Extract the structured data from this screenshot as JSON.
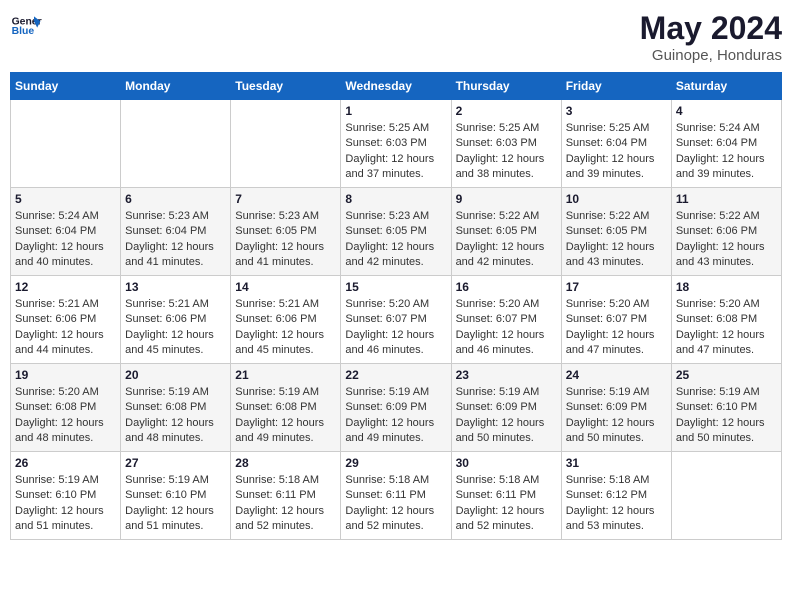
{
  "header": {
    "logo_line1": "General",
    "logo_line2": "Blue",
    "month_year": "May 2024",
    "location": "Guinope, Honduras"
  },
  "weekdays": [
    "Sunday",
    "Monday",
    "Tuesday",
    "Wednesday",
    "Thursday",
    "Friday",
    "Saturday"
  ],
  "weeks": [
    [
      {
        "day": "",
        "info": ""
      },
      {
        "day": "",
        "info": ""
      },
      {
        "day": "",
        "info": ""
      },
      {
        "day": "1",
        "sunrise": "5:25 AM",
        "sunset": "6:03 PM",
        "daylight": "12 hours and 37 minutes."
      },
      {
        "day": "2",
        "sunrise": "5:25 AM",
        "sunset": "6:03 PM",
        "daylight": "12 hours and 38 minutes."
      },
      {
        "day": "3",
        "sunrise": "5:25 AM",
        "sunset": "6:04 PM",
        "daylight": "12 hours and 39 minutes."
      },
      {
        "day": "4",
        "sunrise": "5:24 AM",
        "sunset": "6:04 PM",
        "daylight": "12 hours and 39 minutes."
      }
    ],
    [
      {
        "day": "5",
        "sunrise": "5:24 AM",
        "sunset": "6:04 PM",
        "daylight": "12 hours and 40 minutes."
      },
      {
        "day": "6",
        "sunrise": "5:23 AM",
        "sunset": "6:04 PM",
        "daylight": "12 hours and 41 minutes."
      },
      {
        "day": "7",
        "sunrise": "5:23 AM",
        "sunset": "6:05 PM",
        "daylight": "12 hours and 41 minutes."
      },
      {
        "day": "8",
        "sunrise": "5:23 AM",
        "sunset": "6:05 PM",
        "daylight": "12 hours and 42 minutes."
      },
      {
        "day": "9",
        "sunrise": "5:22 AM",
        "sunset": "6:05 PM",
        "daylight": "12 hours and 42 minutes."
      },
      {
        "day": "10",
        "sunrise": "5:22 AM",
        "sunset": "6:05 PM",
        "daylight": "12 hours and 43 minutes."
      },
      {
        "day": "11",
        "sunrise": "5:22 AM",
        "sunset": "6:06 PM",
        "daylight": "12 hours and 43 minutes."
      }
    ],
    [
      {
        "day": "12",
        "sunrise": "5:21 AM",
        "sunset": "6:06 PM",
        "daylight": "12 hours and 44 minutes."
      },
      {
        "day": "13",
        "sunrise": "5:21 AM",
        "sunset": "6:06 PM",
        "daylight": "12 hours and 45 minutes."
      },
      {
        "day": "14",
        "sunrise": "5:21 AM",
        "sunset": "6:06 PM",
        "daylight": "12 hours and 45 minutes."
      },
      {
        "day": "15",
        "sunrise": "5:20 AM",
        "sunset": "6:07 PM",
        "daylight": "12 hours and 46 minutes."
      },
      {
        "day": "16",
        "sunrise": "5:20 AM",
        "sunset": "6:07 PM",
        "daylight": "12 hours and 46 minutes."
      },
      {
        "day": "17",
        "sunrise": "5:20 AM",
        "sunset": "6:07 PM",
        "daylight": "12 hours and 47 minutes."
      },
      {
        "day": "18",
        "sunrise": "5:20 AM",
        "sunset": "6:08 PM",
        "daylight": "12 hours and 47 minutes."
      }
    ],
    [
      {
        "day": "19",
        "sunrise": "5:20 AM",
        "sunset": "6:08 PM",
        "daylight": "12 hours and 48 minutes."
      },
      {
        "day": "20",
        "sunrise": "5:19 AM",
        "sunset": "6:08 PM",
        "daylight": "12 hours and 48 minutes."
      },
      {
        "day": "21",
        "sunrise": "5:19 AM",
        "sunset": "6:08 PM",
        "daylight": "12 hours and 49 minutes."
      },
      {
        "day": "22",
        "sunrise": "5:19 AM",
        "sunset": "6:09 PM",
        "daylight": "12 hours and 49 minutes."
      },
      {
        "day": "23",
        "sunrise": "5:19 AM",
        "sunset": "6:09 PM",
        "daylight": "12 hours and 50 minutes."
      },
      {
        "day": "24",
        "sunrise": "5:19 AM",
        "sunset": "6:09 PM",
        "daylight": "12 hours and 50 minutes."
      },
      {
        "day": "25",
        "sunrise": "5:19 AM",
        "sunset": "6:10 PM",
        "daylight": "12 hours and 50 minutes."
      }
    ],
    [
      {
        "day": "26",
        "sunrise": "5:19 AM",
        "sunset": "6:10 PM",
        "daylight": "12 hours and 51 minutes."
      },
      {
        "day": "27",
        "sunrise": "5:19 AM",
        "sunset": "6:10 PM",
        "daylight": "12 hours and 51 minutes."
      },
      {
        "day": "28",
        "sunrise": "5:18 AM",
        "sunset": "6:11 PM",
        "daylight": "12 hours and 52 minutes."
      },
      {
        "day": "29",
        "sunrise": "5:18 AM",
        "sunset": "6:11 PM",
        "daylight": "12 hours and 52 minutes."
      },
      {
        "day": "30",
        "sunrise": "5:18 AM",
        "sunset": "6:11 PM",
        "daylight": "12 hours and 52 minutes."
      },
      {
        "day": "31",
        "sunrise": "5:18 AM",
        "sunset": "6:12 PM",
        "daylight": "12 hours and 53 minutes."
      },
      {
        "day": "",
        "info": ""
      }
    ]
  ]
}
